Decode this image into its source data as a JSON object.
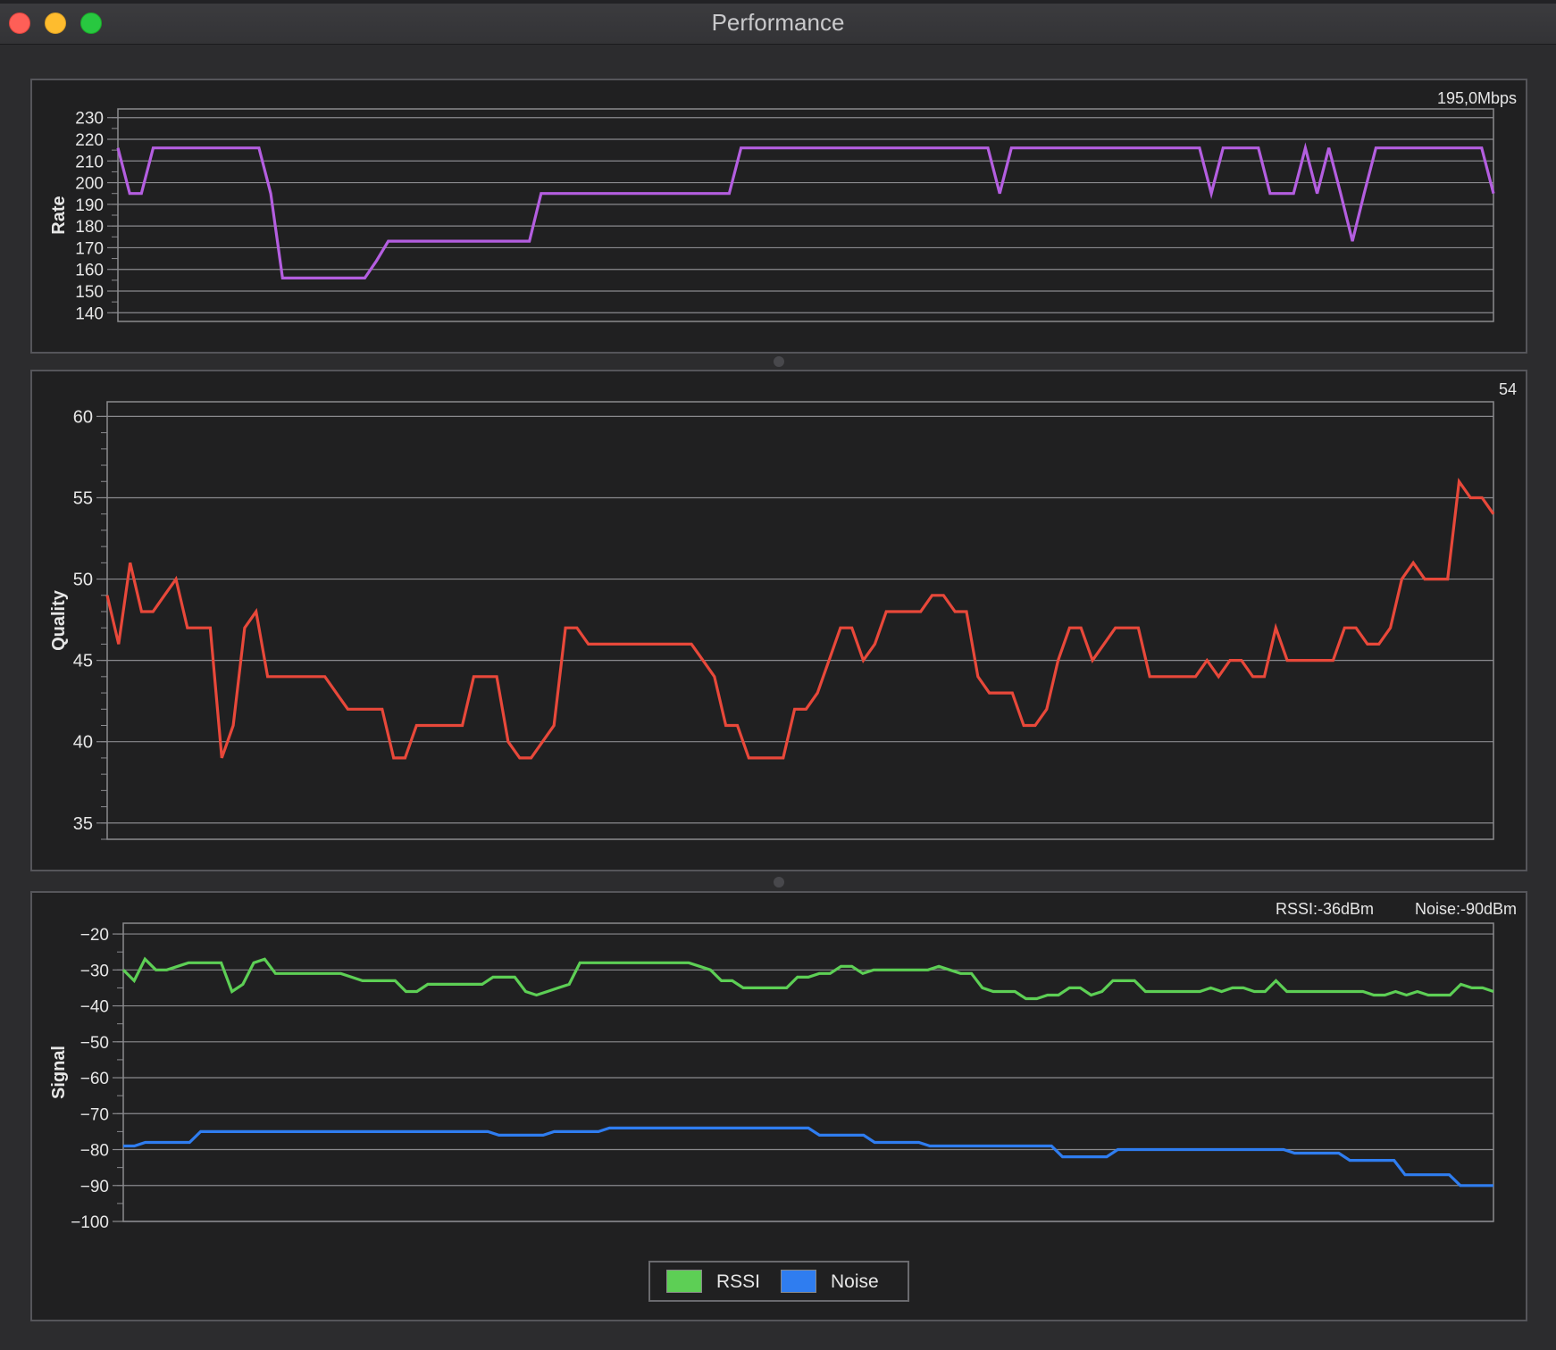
{
  "window": {
    "title": "Performance"
  },
  "colors": {
    "rate": "#b45ee0",
    "quality": "#e8483a",
    "rssi": "#5dcf55",
    "noise": "#2f7df0",
    "grid": "#8a8a8e",
    "text": "#e6e6e6"
  },
  "rate_panel": {
    "readout": "195,0Mbps"
  },
  "quality_panel": {
    "readout": "54"
  },
  "signal_panel": {
    "rssi_readout": "RSSI:-36dBm",
    "noise_readout": "Noise:-90dBm"
  },
  "legend": {
    "items": [
      {
        "label": "RSSI",
        "color": "#5dcf55"
      },
      {
        "label": "Noise",
        "color": "#2f7df0"
      }
    ]
  },
  "chart_data": [
    {
      "type": "line",
      "ylabel": "Rate",
      "ylim": [
        136,
        234
      ],
      "yticks": [
        140,
        150,
        160,
        170,
        180,
        190,
        200,
        210,
        220,
        230
      ],
      "grid": true,
      "series": [
        {
          "color": "#b45ee0",
          "values": [
            216,
            195,
            195,
            216,
            216,
            216,
            216,
            216,
            216,
            216,
            216,
            216,
            216,
            195,
            156,
            156,
            156,
            156,
            156,
            156,
            156,
            156,
            164,
            173,
            173,
            173,
            173,
            173,
            173,
            173,
            173,
            173,
            173,
            173,
            173,
            173,
            195,
            195,
            195,
            195,
            195,
            195,
            195,
            195,
            195,
            195,
            195,
            195,
            195,
            195,
            195,
            195,
            195,
            216,
            216,
            216,
            216,
            216,
            216,
            216,
            216,
            216,
            216,
            216,
            216,
            216,
            216,
            216,
            216,
            216,
            216,
            216,
            216,
            216,
            216,
            195,
            216,
            216,
            216,
            216,
            216,
            216,
            216,
            216,
            216,
            216,
            216,
            216,
            216,
            216,
            216,
            216,
            216,
            195,
            216,
            216,
            216,
            216,
            195,
            195,
            195,
            216,
            195,
            216,
            195,
            173,
            195,
            216,
            216,
            216,
            216,
            216,
            216,
            216,
            216,
            216,
            216,
            195
          ]
        }
      ]
    },
    {
      "type": "line",
      "ylabel": "Quality",
      "ylim": [
        34,
        60.9
      ],
      "yticks": [
        35,
        40,
        45,
        50,
        55,
        60
      ],
      "grid": true,
      "series": [
        {
          "color": "#e8483a",
          "values": [
            49,
            46,
            51,
            48,
            48,
            49,
            50,
            47,
            47,
            47,
            39,
            41,
            47,
            48,
            44,
            44,
            44,
            44,
            44,
            44,
            43,
            42,
            42,
            42,
            42,
            39,
            39,
            41,
            41,
            41,
            41,
            41,
            44,
            44,
            44,
            40,
            39,
            39,
            40,
            41,
            47,
            47,
            46,
            46,
            46,
            46,
            46,
            46,
            46,
            46,
            46,
            46,
            45,
            44,
            41,
            41,
            39,
            39,
            39,
            39,
            42,
            42,
            43,
            45,
            47,
            47,
            45,
            46,
            48,
            48,
            48,
            48,
            49,
            49,
            48,
            48,
            44,
            43,
            43,
            43,
            41,
            41,
            42,
            45,
            47,
            47,
            45,
            46,
            47,
            47,
            47,
            44,
            44,
            44,
            44,
            44,
            45,
            44,
            45,
            45,
            44,
            44,
            47,
            45,
            45,
            45,
            45,
            45,
            47,
            47,
            46,
            46,
            47,
            50,
            51,
            50,
            50,
            50,
            56,
            55,
            55,
            54
          ]
        }
      ]
    },
    {
      "type": "line",
      "ylabel": "Signal",
      "ylim": [
        -100,
        -17
      ],
      "yticks": [
        -20,
        -30,
        -40,
        -50,
        -60,
        -70,
        -80,
        -90,
        -100
      ],
      "grid": true,
      "legend": "bottom-center",
      "series": [
        {
          "name": "RSSI",
          "color": "#5dcf55",
          "values": [
            -30,
            -33,
            -27,
            -30,
            -30,
            -29,
            -28,
            -28,
            -28,
            -28,
            -36,
            -34,
            -28,
            -27,
            -31,
            -31,
            -31,
            -31,
            -31,
            -31,
            -31,
            -32,
            -33,
            -33,
            -33,
            -33,
            -36,
            -36,
            -34,
            -34,
            -34,
            -34,
            -34,
            -34,
            -32,
            -32,
            -32,
            -36,
            -37,
            -36,
            -35,
            -34,
            -28,
            -28,
            -28,
            -28,
            -28,
            -28,
            -28,
            -28,
            -28,
            -28,
            -28,
            -29,
            -30,
            -33,
            -33,
            -35,
            -35,
            -35,
            -35,
            -35,
            -32,
            -32,
            -31,
            -31,
            -29,
            -29,
            -31,
            -30,
            -30,
            -30,
            -30,
            -30,
            -30,
            -29,
            -30,
            -31,
            -31,
            -35,
            -36,
            -36,
            -36,
            -38,
            -38,
            -37,
            -37,
            -35,
            -35,
            -37,
            -36,
            -33,
            -33,
            -33,
            -36,
            -36,
            -36,
            -36,
            -36,
            -36,
            -35,
            -36,
            -35,
            -35,
            -36,
            -36,
            -33,
            -36,
            -36,
            -36,
            -36,
            -36,
            -36,
            -36,
            -36,
            -37,
            -37,
            -36,
            -37,
            -36,
            -37,
            -37,
            -37,
            -34,
            -35,
            -35,
            -36
          ]
        },
        {
          "name": "Noise",
          "color": "#2f7df0",
          "values": [
            -79,
            -79,
            -78,
            -78,
            -78,
            -78,
            -78,
            -75,
            -75,
            -75,
            -75,
            -75,
            -75,
            -75,
            -75,
            -75,
            -75,
            -75,
            -75,
            -75,
            -75,
            -75,
            -75,
            -75,
            -75,
            -75,
            -75,
            -75,
            -75,
            -75,
            -75,
            -75,
            -75,
            -75,
            -76,
            -76,
            -76,
            -76,
            -76,
            -75,
            -75,
            -75,
            -75,
            -75,
            -74,
            -74,
            -74,
            -74,
            -74,
            -74,
            -74,
            -74,
            -74,
            -74,
            -74,
            -74,
            -74,
            -74,
            -74,
            -74,
            -74,
            -74,
            -74,
            -76,
            -76,
            -76,
            -76,
            -76,
            -78,
            -78,
            -78,
            -78,
            -78,
            -79,
            -79,
            -79,
            -79,
            -79,
            -79,
            -79,
            -79,
            -79,
            -79,
            -79,
            -79,
            -82,
            -82,
            -82,
            -82,
            -82,
            -80,
            -80,
            -80,
            -80,
            -80,
            -80,
            -80,
            -80,
            -80,
            -80,
            -80,
            -80,
            -80,
            -80,
            -80,
            -80,
            -81,
            -81,
            -81,
            -81,
            -81,
            -83,
            -83,
            -83,
            -83,
            -83,
            -87,
            -87,
            -87,
            -87,
            -87,
            -90,
            -90,
            -90,
            -90
          ]
        }
      ]
    }
  ]
}
